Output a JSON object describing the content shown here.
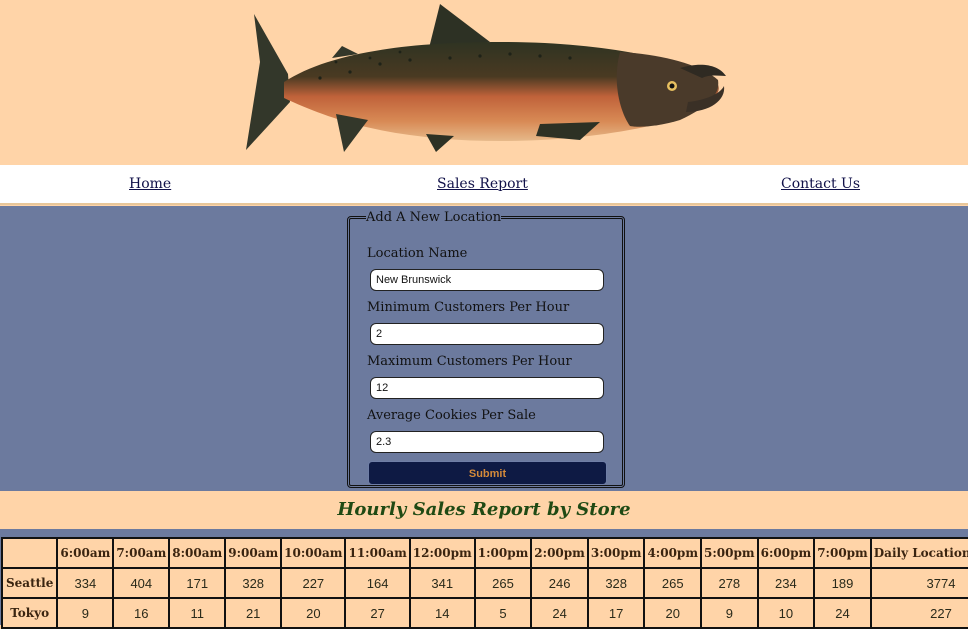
{
  "header": {
    "hero_image": "salmon-illustration"
  },
  "nav": {
    "home": "Home",
    "sales_report": "Sales Report",
    "contact_us": "Contact Us"
  },
  "form": {
    "legend": "Add A New Location",
    "location_name_label": "Location Name",
    "location_name_value": "New Brunswick",
    "min_customers_label": "Minimum Customers Per Hour",
    "min_customers_value": "2",
    "max_customers_label": "Maximum Customers Per Hour",
    "max_customers_value": "12",
    "avg_cookies_label": "Average Cookies Per Sale",
    "avg_cookies_value": "2.3",
    "submit_label": "Submit"
  },
  "report": {
    "title": "Hourly Sales Report by Store",
    "headers": [
      "",
      "6:00am",
      "7:00am",
      "8:00am",
      "9:00am",
      "10:00am",
      "11:00am",
      "12:00pm",
      "1:00pm",
      "2:00pm",
      "3:00pm",
      "4:00pm",
      "5:00pm",
      "6:00pm",
      "7:00pm",
      "Daily Location Total"
    ],
    "rows": [
      {
        "store": "Seattle",
        "values": [
          "334",
          "404",
          "171",
          "328",
          "227",
          "164",
          "341",
          "265",
          "246",
          "328",
          "265",
          "278",
          "234",
          "189",
          "3774"
        ]
      },
      {
        "store": "Tokyo",
        "values": [
          "9",
          "16",
          "11",
          "21",
          "20",
          "27",
          "14",
          "5",
          "24",
          "17",
          "20",
          "9",
          "10",
          "24",
          "227"
        ]
      }
    ]
  },
  "colors": {
    "page_bg": "#ffd4a8",
    "band_bg": "#6c7a9e",
    "button_bg": "#0e1a44",
    "button_text": "#d48a3a",
    "title_green": "#1f4a14"
  }
}
